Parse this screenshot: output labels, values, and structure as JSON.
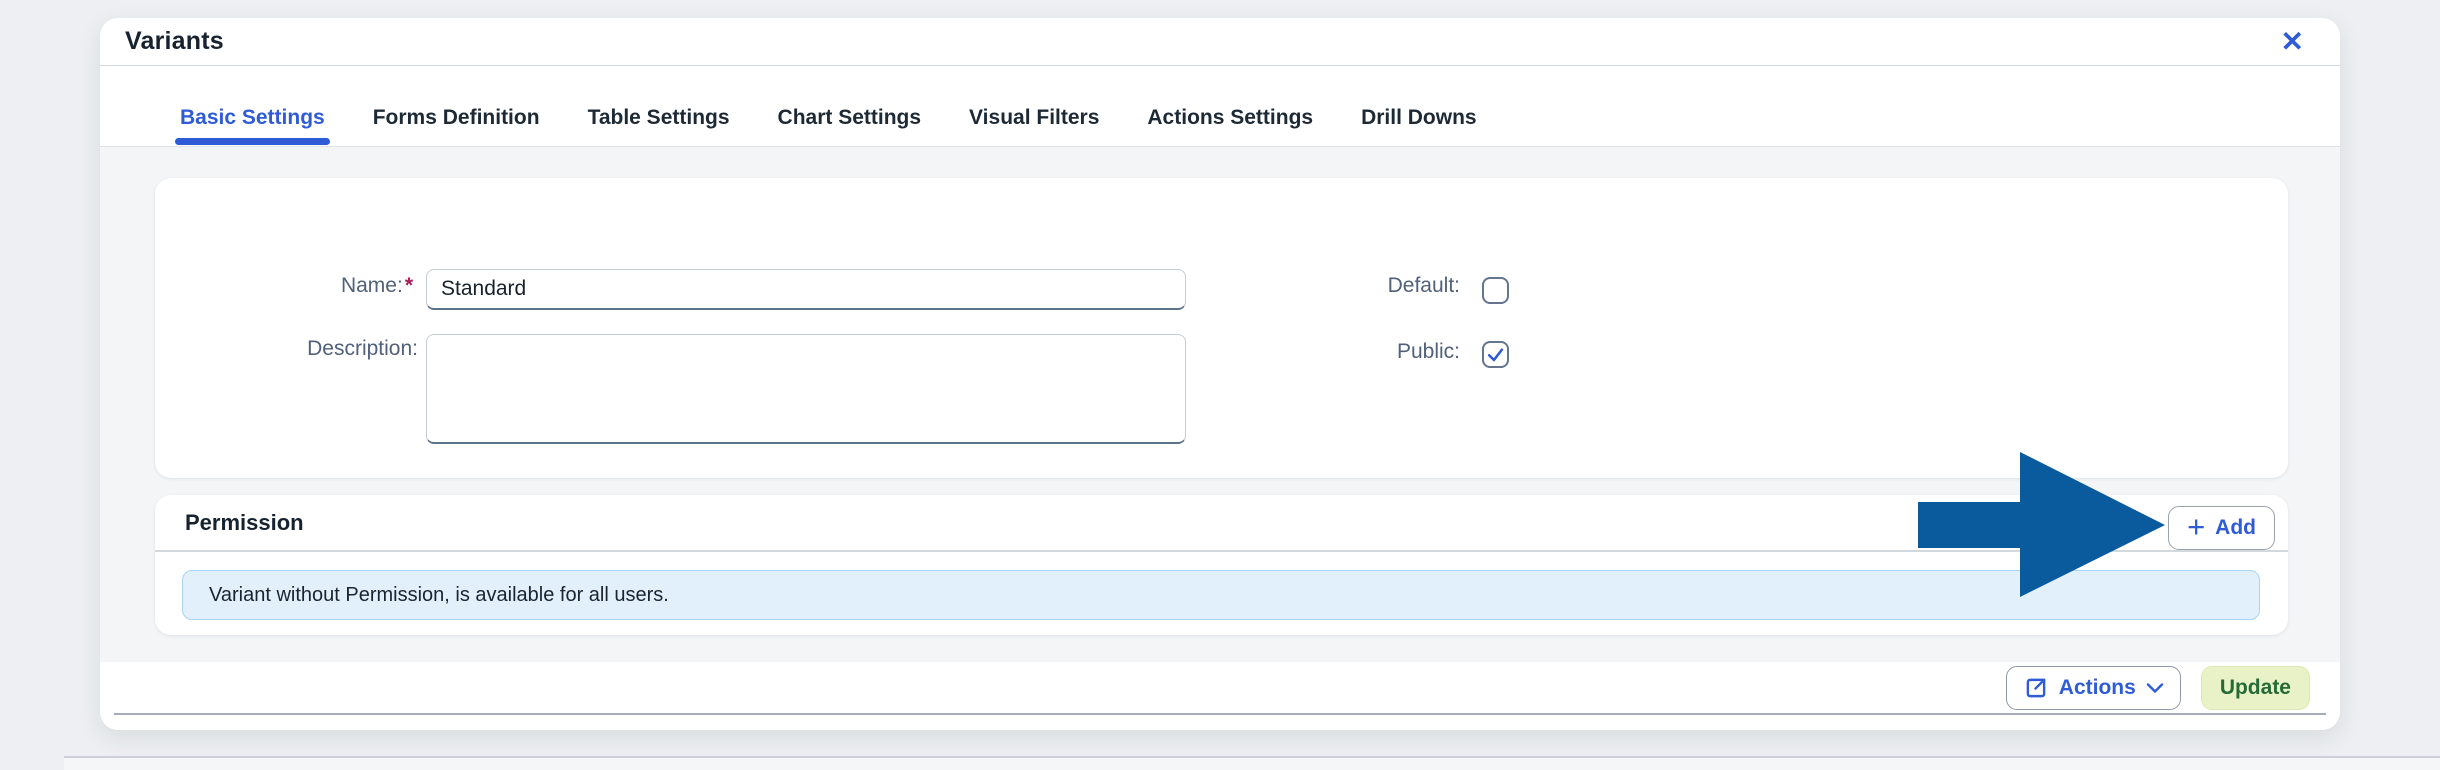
{
  "dialog": {
    "title": "Variants",
    "close_icon": "✕"
  },
  "tabs": [
    {
      "label": "Basic Settings",
      "active": true
    },
    {
      "label": "Forms Definition",
      "active": false
    },
    {
      "label": "Table Settings",
      "active": false
    },
    {
      "label": "Chart Settings",
      "active": false
    },
    {
      "label": "Visual Filters",
      "active": false
    },
    {
      "label": "Actions Settings",
      "active": false
    },
    {
      "label": "Drill Downs",
      "active": false
    }
  ],
  "form": {
    "name": {
      "label": "Name:",
      "required_marker": "*",
      "value": "Standard"
    },
    "description": {
      "label": "Description:",
      "value": ""
    },
    "default": {
      "label": "Default:",
      "checked": false
    },
    "public": {
      "label": "Public:",
      "checked": true
    }
  },
  "permission": {
    "title": "Permission",
    "add_button": {
      "plus": "+",
      "label": "Add"
    },
    "info_message": "Variant without Permission, is available for all users."
  },
  "footer": {
    "actions_label": "Actions",
    "update_label": "Update"
  },
  "annotation": {
    "arrow_color": "#0a5a9e"
  },
  "colors": {
    "accent_blue": "#2f5bd7",
    "arrow_blue": "#0a5a9e",
    "info_bg": "#e2f0fb",
    "info_border": "#a7d5f4",
    "update_bg": "#e9f2c6",
    "update_text": "#246b36",
    "label_text": "#51617a",
    "content_bg": "#f4f5f7"
  }
}
